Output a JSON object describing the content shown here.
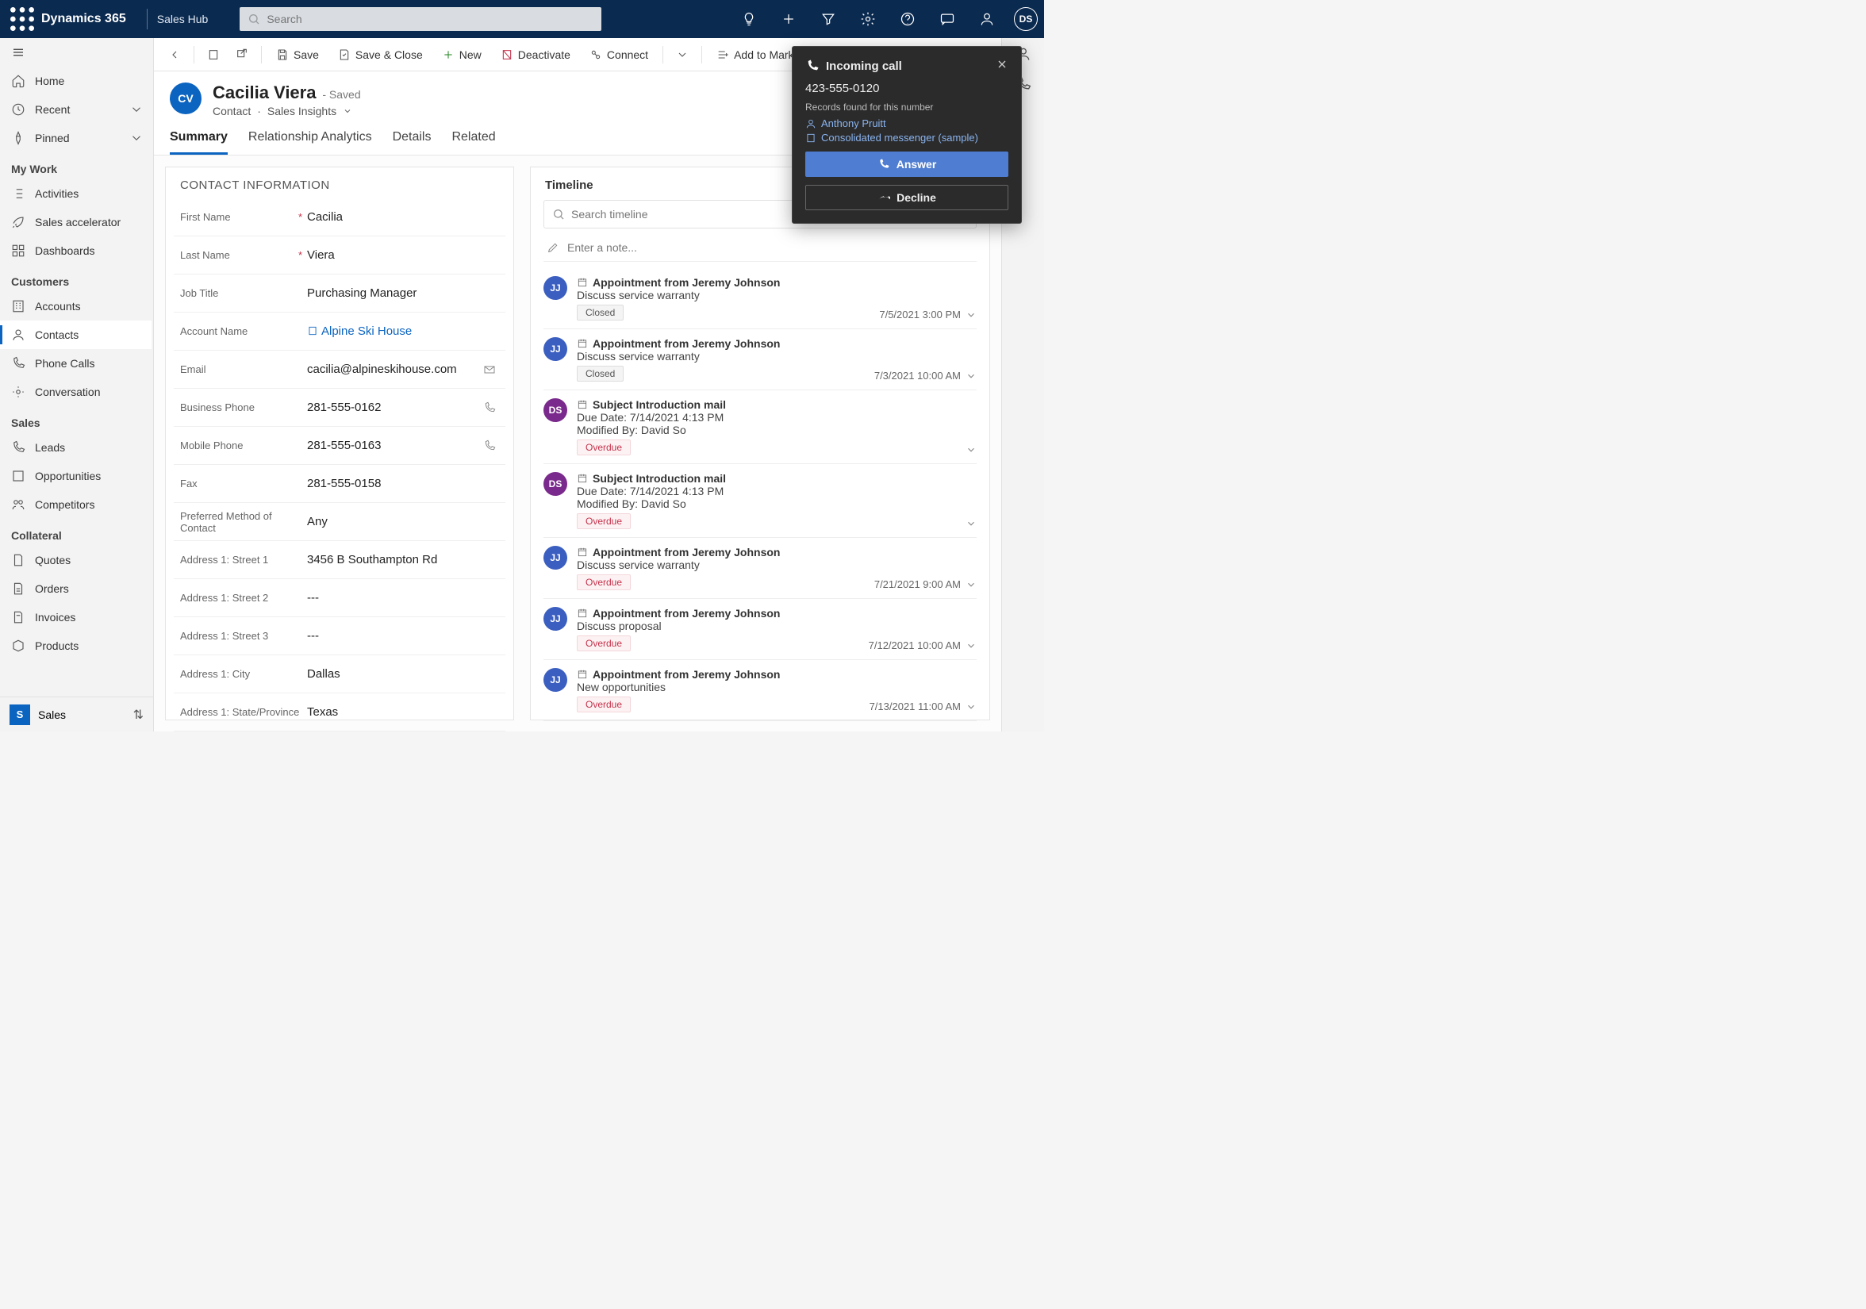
{
  "topnav": {
    "brand": "Dynamics 365",
    "hub": "Sales Hub",
    "search_placeholder": "Search",
    "avatar": "DS"
  },
  "sidebar": {
    "home": "Home",
    "recent": "Recent",
    "pinned": "Pinned",
    "sections": {
      "mywork": "My Work",
      "customers": "Customers",
      "sales": "Sales",
      "collateral": "Collateral"
    },
    "items": {
      "activities": "Activities",
      "accel": "Sales accelerator",
      "dash": "Dashboards",
      "accounts": "Accounts",
      "contacts": "Contacts",
      "phone": "Phone Calls",
      "conv": "Conversation",
      "leads": "Leads",
      "opps": "Opportunities",
      "comp": "Competitors",
      "quotes": "Quotes",
      "orders": "Orders",
      "inv": "Invoices",
      "prod": "Products"
    },
    "footer": {
      "badge": "S",
      "label": "Sales"
    }
  },
  "cmd": {
    "save": "Save",
    "saveclose": "Save & Close",
    "new": "New",
    "deact": "Deactivate",
    "connect": "Connect",
    "marketing": "Add to Marketing List"
  },
  "record": {
    "initials": "CV",
    "name": "Cacilia Viera",
    "status": " - Saved",
    "entity": "Contact",
    "form": "Sales Insights"
  },
  "tabs": {
    "summary": "Summary",
    "rel": "Relationship Analytics",
    "details": "Details",
    "related": "Related"
  },
  "contactinfo": {
    "title": "CONTACT INFORMATION",
    "labels": {
      "first": "First Name",
      "last": "Last Name",
      "job": "Job Title",
      "account": "Account Name",
      "email": "Email",
      "bphone": "Business Phone",
      "mphone": "Mobile Phone",
      "fax": "Fax",
      "pref": "Preferred Method of Contact",
      "st1": "Address 1: Street 1",
      "st2": "Address 1: Street 2",
      "st3": "Address 1: Street 3",
      "city": "Address 1: City",
      "state": "Address 1: State/Province"
    },
    "values": {
      "first": "Cacilia",
      "last": "Viera",
      "job": "Purchasing Manager",
      "account": "Alpine Ski House",
      "email": "cacilia@alpineskihouse.com",
      "bphone": "281-555-0162",
      "mphone": "281-555-0163",
      "fax": "281-555-0158",
      "pref": "Any",
      "st1": "3456 B Southampton Rd",
      "st2": "---",
      "st3": "---",
      "city": "Dallas",
      "state": "Texas"
    }
  },
  "timeline": {
    "title": "Timeline",
    "search_placeholder": "Search timeline",
    "note_placeholder": "Enter a note...",
    "items": [
      {
        "avatar": "JJ",
        "color": "#3b5fc0",
        "title": "Appointment from Jeremy Johnson",
        "desc": "Discuss service warranty",
        "badge": "Closed",
        "badgeType": "closed",
        "date": "7/5/2021 3:00 PM"
      },
      {
        "avatar": "JJ",
        "color": "#3b5fc0",
        "title": "Appointment from Jeremy Johnson",
        "desc": "Discuss service warranty",
        "badge": "Closed",
        "badgeType": "closed",
        "date": "7/3/2021 10:00 AM"
      },
      {
        "avatar": "DS",
        "color": "#7a2a8c",
        "title": "Subject Introduction mail",
        "desc": "Due Date: 7/14/2021 4:13 PM",
        "desc2": "Modified By: David So",
        "badge": "Overdue",
        "badgeType": "over",
        "date": ""
      },
      {
        "avatar": "DS",
        "color": "#7a2a8c",
        "title": "Subject Introduction mail",
        "desc": "Due Date: 7/14/2021 4:13 PM",
        "desc2": "Modified By: David So",
        "badge": "Overdue",
        "badgeType": "over",
        "date": ""
      },
      {
        "avatar": "JJ",
        "color": "#3b5fc0",
        "title": "Appointment from Jeremy Johnson",
        "desc": "Discuss service warranty",
        "badge": "Overdue",
        "badgeType": "over",
        "date": "7/21/2021 9:00 AM"
      },
      {
        "avatar": "JJ",
        "color": "#3b5fc0",
        "title": "Appointment from Jeremy Johnson",
        "desc": "Discuss proposal",
        "badge": "Overdue",
        "badgeType": "over",
        "date": "7/12/2021 10:00 AM"
      },
      {
        "avatar": "JJ",
        "color": "#3b5fc0",
        "title": "Appointment from Jeremy Johnson",
        "desc": "New opportunities",
        "badge": "Overdue",
        "badgeType": "over",
        "date": "7/13/2021 11:00 AM"
      }
    ]
  },
  "call": {
    "title": "Incoming call",
    "number": "423-555-0120",
    "records_label": "Records found for this number",
    "record1": "Anthony Pruitt",
    "record2": "Consolidated messenger (sample)",
    "answer": "Answer",
    "decline": "Decline"
  }
}
